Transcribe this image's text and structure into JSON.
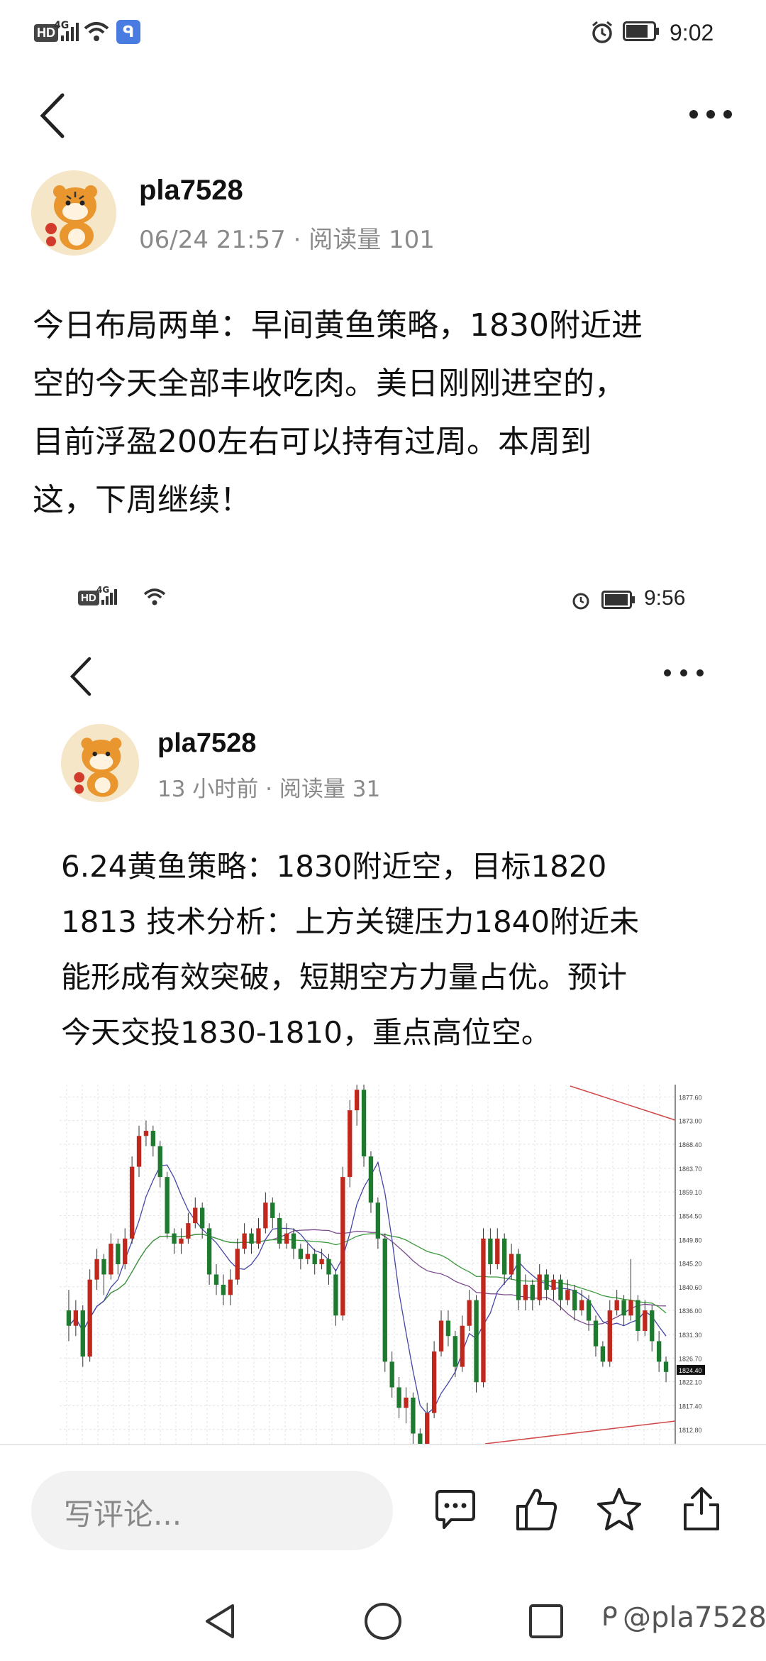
{
  "status_bar": {
    "hd": "HD",
    "net": "4G",
    "time": "9:02"
  },
  "header": {
    "back": "back",
    "more": "more"
  },
  "post": {
    "author": "pla7528",
    "meta": "06/24 21:57 · 阅读量 101",
    "lines": [
      "今日布局两单：早间黄鱼策略，1830附近进",
      "空的今天全部丰收吃肉。美日刚刚进空的，",
      "目前浮盈200左右可以持有过周。本周到",
      "这，下周继续！"
    ]
  },
  "embedded": {
    "status_bar": {
      "hd": "HD",
      "net": "4G",
      "time": "9:56"
    },
    "author": "pla7528",
    "meta": "13 小时前 · 阅读量 31",
    "lines": [
      "6.24黄鱼策略：1830附近空，目标1820",
      "1813 技术分析：上方关键压力1840附近未",
      "能形成有效突破，短期空方力量占优。预计",
      "今天交投1830-1810，重点高位空。"
    ]
  },
  "chart_data": {
    "type": "candlestick",
    "y_ticks": [
      "1877.60",
      "1873.00",
      "1868.40",
      "1863.70",
      "1859.10",
      "1854.50",
      "1849.80",
      "1845.20",
      "1840.60",
      "1836.00",
      "1831.30",
      "1826.70",
      "1822.10",
      "1817.40",
      "1812.80"
    ],
    "current_price": "1824.40",
    "ylim": [
      1810,
      1880
    ],
    "candles": [
      [
        1836,
        1833,
        1840,
        1830
      ],
      [
        1833,
        1836,
        1838,
        1831
      ],
      [
        1836,
        1827,
        1837,
        1825
      ],
      [
        1827,
        1842,
        1844,
        1826
      ],
      [
        1842,
        1846,
        1848,
        1840
      ],
      [
        1846,
        1843,
        1847,
        1839
      ],
      [
        1843,
        1849,
        1851,
        1842
      ],
      [
        1849,
        1845,
        1850,
        1843
      ],
      [
        1845,
        1850,
        1852,
        1844
      ],
      [
        1850,
        1864,
        1866,
        1849
      ],
      [
        1864,
        1870,
        1872,
        1862
      ],
      [
        1870,
        1871,
        1873,
        1868
      ],
      [
        1871,
        1868,
        1872,
        1866
      ],
      [
        1868,
        1862,
        1869,
        1860
      ],
      [
        1862,
        1851,
        1863,
        1850
      ],
      [
        1851,
        1849,
        1852,
        1847
      ],
      [
        1849,
        1850,
        1852,
        1847
      ],
      [
        1850,
        1853,
        1855,
        1849
      ],
      [
        1853,
        1856,
        1858,
        1852
      ],
      [
        1856,
        1852,
        1857,
        1850
      ],
      [
        1852,
        1843,
        1853,
        1841
      ],
      [
        1843,
        1841,
        1845,
        1839
      ],
      [
        1841,
        1839,
        1843,
        1837
      ],
      [
        1839,
        1842,
        1844,
        1837
      ],
      [
        1842,
        1848,
        1850,
        1841
      ],
      [
        1848,
        1851,
        1853,
        1847
      ],
      [
        1851,
        1849,
        1852,
        1847
      ],
      [
        1849,
        1852,
        1854,
        1848
      ],
      [
        1852,
        1857,
        1859,
        1851
      ],
      [
        1857,
        1854,
        1858,
        1852
      ],
      [
        1854,
        1849,
        1855,
        1848
      ],
      [
        1849,
        1851,
        1853,
        1848
      ],
      [
        1851,
        1848,
        1852,
        1846
      ],
      [
        1848,
        1846,
        1849,
        1844
      ],
      [
        1846,
        1847,
        1849,
        1845
      ],
      [
        1847,
        1845,
        1848,
        1843
      ],
      [
        1845,
        1846,
        1848,
        1844
      ],
      [
        1846,
        1843,
        1847,
        1841
      ],
      [
        1843,
        1835,
        1844,
        1833
      ],
      [
        1835,
        1862,
        1864,
        1834
      ],
      [
        1862,
        1875,
        1877,
        1860
      ],
      [
        1875,
        1879,
        1880,
        1872
      ],
      [
        1879,
        1866,
        1880,
        1864
      ],
      [
        1866,
        1857,
        1867,
        1855
      ],
      [
        1857,
        1850,
        1858,
        1848
      ],
      [
        1850,
        1826,
        1851,
        1824
      ],
      [
        1826,
        1821,
        1828,
        1819
      ],
      [
        1821,
        1817,
        1823,
        1815
      ],
      [
        1817,
        1819,
        1821,
        1814
      ],
      [
        1819,
        1812,
        1820,
        1810
      ],
      [
        1812,
        1810,
        1813,
        1809
      ],
      [
        1810,
        1816,
        1818,
        1809
      ],
      [
        1816,
        1828,
        1830,
        1815
      ],
      [
        1828,
        1834,
        1836,
        1827
      ],
      [
        1834,
        1831,
        1836,
        1829
      ],
      [
        1831,
        1825,
        1832,
        1823
      ],
      [
        1825,
        1833,
        1835,
        1824
      ],
      [
        1833,
        1838,
        1840,
        1832
      ],
      [
        1838,
        1822,
        1839,
        1820
      ],
      [
        1822,
        1850,
        1852,
        1821
      ],
      [
        1850,
        1845,
        1852,
        1843
      ],
      [
        1845,
        1850,
        1852,
        1844
      ],
      [
        1850,
        1843,
        1851,
        1841
      ],
      [
        1843,
        1847,
        1849,
        1842
      ],
      [
        1847,
        1838,
        1848,
        1836
      ],
      [
        1838,
        1841,
        1843,
        1836
      ],
      [
        1841,
        1838,
        1842,
        1836
      ],
      [
        1838,
        1843,
        1845,
        1837
      ],
      [
        1843,
        1840,
        1844,
        1838
      ],
      [
        1840,
        1842,
        1843,
        1838
      ],
      [
        1842,
        1838,
        1843,
        1836
      ],
      [
        1838,
        1840,
        1842,
        1837
      ],
      [
        1840,
        1836,
        1841,
        1834
      ],
      [
        1836,
        1838,
        1840,
        1835
      ],
      [
        1838,
        1834,
        1839,
        1832
      ],
      [
        1834,
        1829,
        1835,
        1827
      ],
      [
        1829,
        1826,
        1830,
        1825
      ],
      [
        1826,
        1836,
        1838,
        1825
      ],
      [
        1836,
        1838,
        1840,
        1835
      ],
      [
        1838,
        1835,
        1839,
        1833
      ],
      [
        1835,
        1838,
        1846,
        1834
      ],
      [
        1838,
        1832,
        1839,
        1830
      ],
      [
        1832,
        1836,
        1838,
        1831
      ],
      [
        1836,
        1830,
        1837,
        1828
      ],
      [
        1830,
        1826,
        1832,
        1824
      ],
      [
        1826,
        1824,
        1827,
        1822
      ]
    ]
  },
  "actions": {
    "comment_placeholder": "写评论...",
    "comment": "comment",
    "like": "like",
    "star": "favorite",
    "share": "share"
  },
  "watermark": "@pla7528",
  "colors": {
    "up": "#c0281e",
    "down": "#1e7a2e",
    "ma1": "#7b4a8e",
    "ma2": "#3b9a3b",
    "ma3": "#4646a6",
    "trend": "#d24848"
  }
}
